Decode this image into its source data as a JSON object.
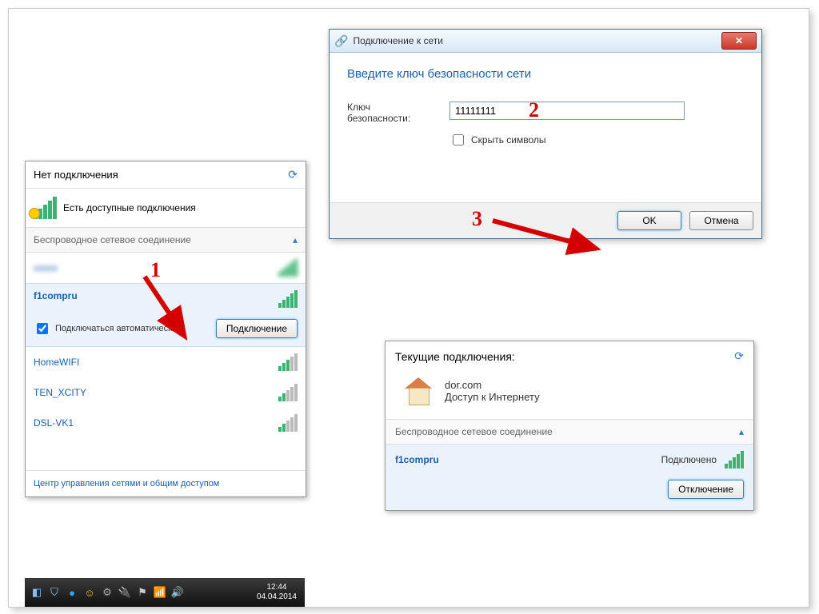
{
  "popup1": {
    "header": "Нет подключения",
    "available_text": "Есть доступные подключения",
    "section_title": "Беспроводное сетевое соединение",
    "networks": {
      "blurred": "xxxxx",
      "selected": {
        "name": "f1compru",
        "auto_label": "Подключаться автоматически",
        "connect_btn": "Подключение"
      },
      "others": [
        "HomeWIFI",
        "TEN_XCITY",
        "DSL-VK1"
      ]
    },
    "footer_link": "Центр управления сетями и общим доступом"
  },
  "taskbar": {
    "time": "12:44",
    "date": "04.04.2014"
  },
  "dialog": {
    "title": "Подключение к сети",
    "heading": "Введите ключ безопасности сети",
    "key_label": "Ключ безопасности:",
    "key_value": "11111111",
    "hide_label": "Скрыть символы",
    "ok": "OK",
    "cancel": "Отмена"
  },
  "popup3": {
    "header": "Текущие подключения:",
    "conn_name": "dor.com",
    "conn_status": "Доступ к Интернету",
    "section_title": "Беспроводное сетевое соединение",
    "net_name": "f1compru",
    "net_status": "Подключено",
    "disconnect_btn": "Отключение"
  },
  "annotations": {
    "n1": "1",
    "n2": "2",
    "n3": "3"
  }
}
